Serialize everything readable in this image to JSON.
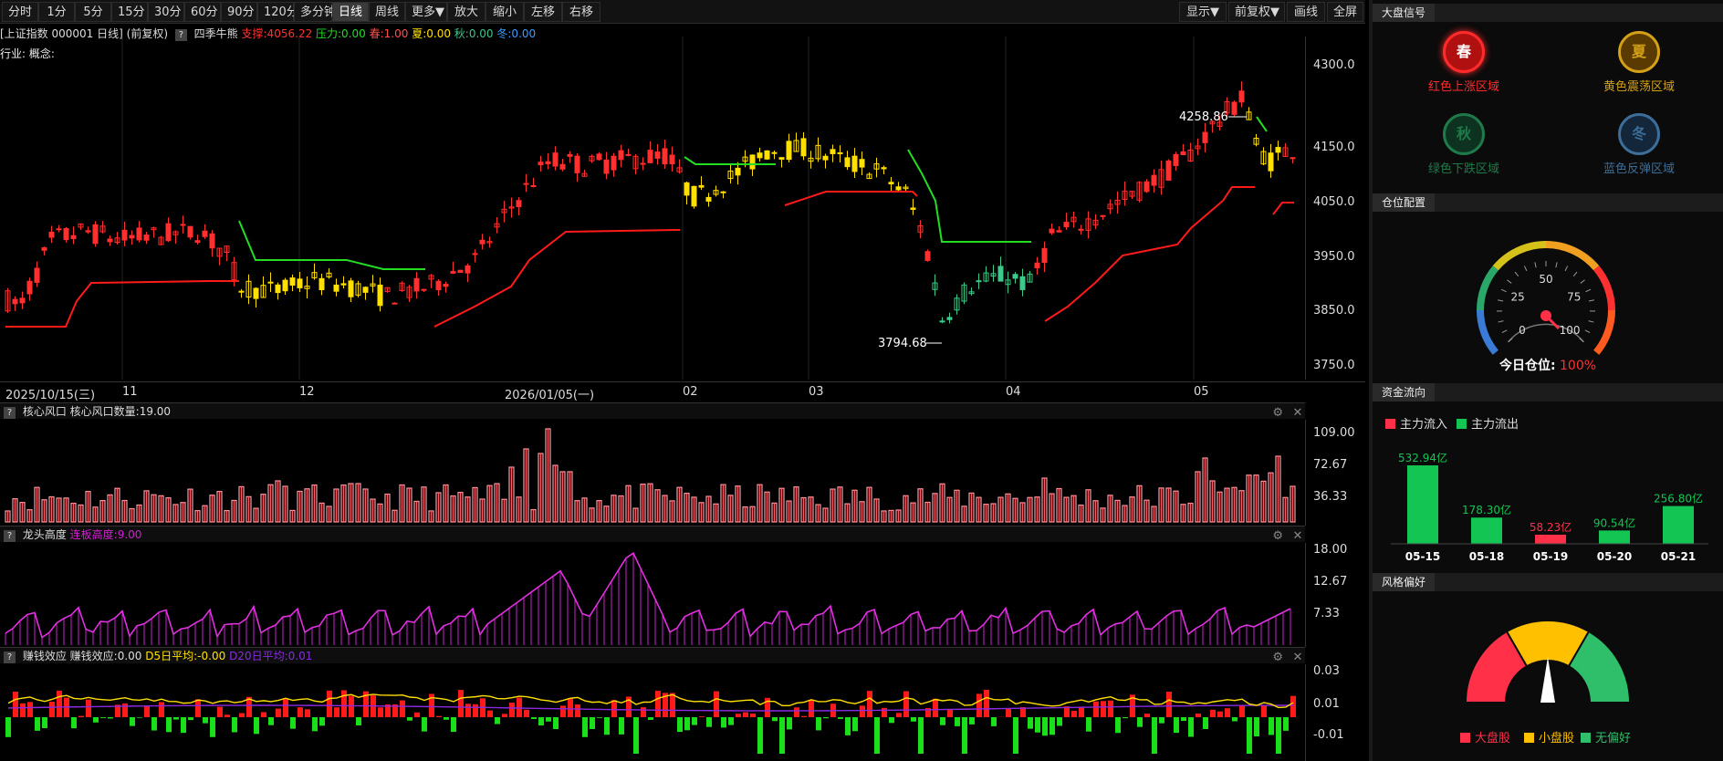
{
  "toolbar": {
    "left": [
      "分时",
      "1分",
      "5分",
      "15分",
      "30分",
      "60分",
      "90分",
      "120分",
      "多分钟",
      "日线",
      "周线",
      "更多▼",
      "放大",
      "缩小",
      "左移",
      "右移"
    ],
    "active": "日线",
    "right": [
      "显示▼",
      "前复权▼",
      "画线",
      "全屏"
    ]
  },
  "main_info": {
    "title": "[上证指数 000001 日线]",
    "adjust": "(前复权)",
    "q": "?",
    "indicator": "四季牛熊",
    "support": "支撑:4056.22",
    "pressure": "压力:0.00",
    "spring": "春:1.00",
    "summer": "夏:0.00",
    "autumn": "秋:0.00",
    "winter": "冬:0.00"
  },
  "industry": "行业: 概念:",
  "price_axis": [
    "4300.0",
    "4150.0",
    "4050.0",
    "3950.0",
    "3850.0",
    "3750.0"
  ],
  "annotations": {
    "high": "4258.86",
    "low": "3794.68"
  },
  "date_axis": [
    "2025/10/15(三)",
    "11",
    "12",
    "2026/01/05(一)",
    "02",
    "03",
    "04",
    "05"
  ],
  "pane1": {
    "q": "?",
    "name": "核心风口",
    "field": "核心风口数量:19.00",
    "axis": [
      "109.00",
      "72.67",
      "36.33"
    ]
  },
  "pane2": {
    "q": "?",
    "name": "龙头高度",
    "field": "连板高度:9.00",
    "axis": [
      "18.00",
      "12.67",
      "7.33"
    ]
  },
  "pane3": {
    "q": "?",
    "name": "赚钱效应",
    "field": "赚钱效应:0.00",
    "d5": "D5日平均:-0.00",
    "d20": "D20日平均:0.01",
    "axis": [
      "0.03",
      "0.01",
      "-0.01"
    ]
  },
  "icons": {
    "gear": "gear-icon",
    "close": "close-icon"
  },
  "side": {
    "signal": {
      "title": "大盘信号",
      "items": [
        {
          "char": "春",
          "label": "红色上涨区域",
          "color": "#ff2a2a",
          "bg": "#b01010",
          "on": true
        },
        {
          "char": "夏",
          "label": "黄色震荡区域",
          "color": "#d4a017",
          "bg": "#5a3a00",
          "on": false
        },
        {
          "char": "秋",
          "label": "绿色下跌区域",
          "color": "#1f7a4a",
          "bg": "#0d3320",
          "on": false
        },
        {
          "char": "冬",
          "label": "蓝色反弹区域",
          "color": "#3c6e99",
          "bg": "#13263a",
          "on": false
        }
      ]
    },
    "position": {
      "title": "仓位配置",
      "ticks": [
        "0",
        "25",
        "50",
        "75",
        "100"
      ],
      "label": "今日仓位:",
      "value": "100%"
    },
    "flow": {
      "title": "资金流向",
      "legend_in": "主力流入",
      "legend_out": "主力流出",
      "bars": [
        {
          "date": "05-15",
          "value": "532.94亿",
          "num": 532.94,
          "dir": "out"
        },
        {
          "date": "05-18",
          "value": "178.30亿",
          "num": 178.3,
          "dir": "out"
        },
        {
          "date": "05-19",
          "value": "58.23亿",
          "num": 58.23,
          "dir": "in"
        },
        {
          "date": "05-20",
          "value": "90.54亿",
          "num": 90.54,
          "dir": "out"
        },
        {
          "date": "05-21",
          "value": "256.80亿",
          "num": 256.8,
          "dir": "out"
        }
      ]
    },
    "style": {
      "title": "风格偏好",
      "legend": [
        "大盘股",
        "小盘股",
        "无偏好"
      ]
    }
  },
  "colors": {
    "up": "#ff3030",
    "down_green": "#3cc98a",
    "yellow": "#ffe000",
    "support": "#ff1a1a",
    "pressure": "#22dd22",
    "pink": "#ff9aa0",
    "magenta": "#d020d0"
  }
}
